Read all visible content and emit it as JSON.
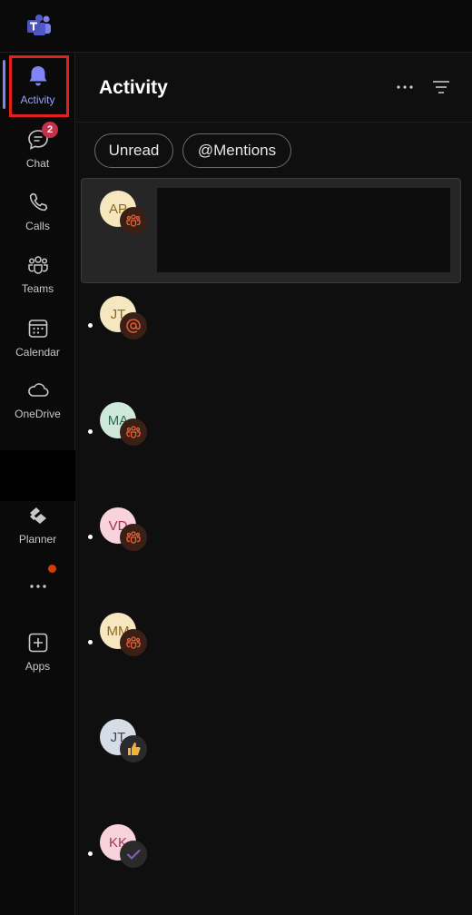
{
  "rail": {
    "items": [
      {
        "label": "Activity"
      },
      {
        "label": "Chat",
        "badge": "2"
      },
      {
        "label": "Calls"
      },
      {
        "label": "Teams"
      },
      {
        "label": "Calendar"
      },
      {
        "label": "OneDrive"
      },
      {
        "label": "Planner"
      },
      {
        "label": "Apps"
      }
    ]
  },
  "header": {
    "title": "Activity"
  },
  "filters": {
    "unread": "Unread",
    "mentions": "@Mentions"
  },
  "feed": [
    {
      "initials": "AP",
      "type": "team"
    },
    {
      "initials": "JT",
      "type": "mention"
    },
    {
      "initials": "MA",
      "type": "team"
    },
    {
      "initials": "VD",
      "type": "team"
    },
    {
      "initials": "MM",
      "type": "team"
    },
    {
      "initials": "JT",
      "type": "like"
    },
    {
      "initials": "KK",
      "type": "check"
    }
  ],
  "colors": {
    "accent": "#7f85f5",
    "badge": "#c4314b",
    "highlight": "#e3201b",
    "team_icon": "#e8643a"
  }
}
